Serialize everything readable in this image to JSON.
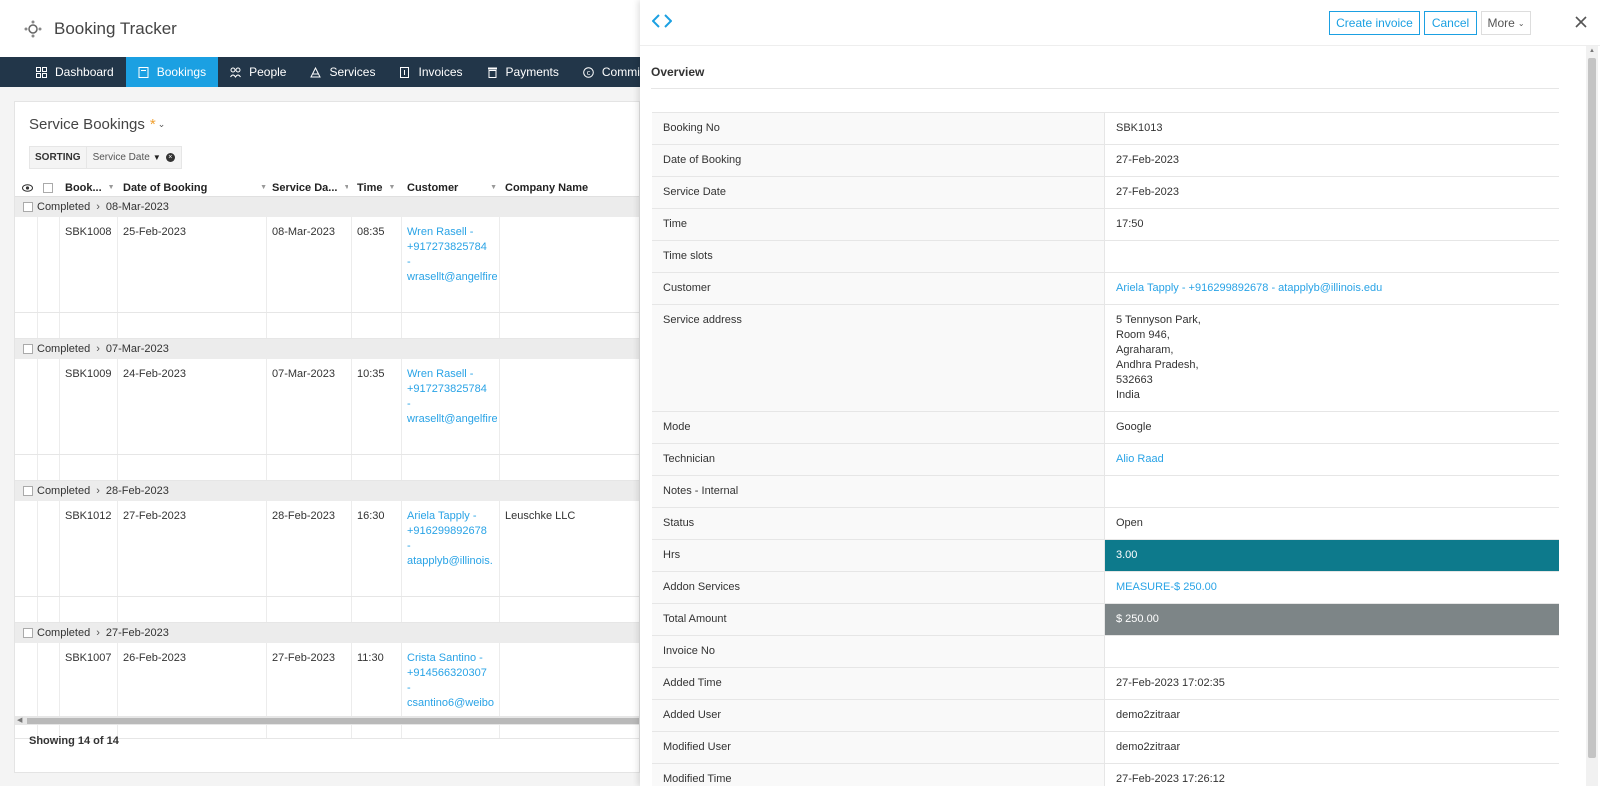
{
  "app": {
    "title": "Booking Tracker"
  },
  "nav": [
    {
      "label": "Dashboard",
      "icon": "dashboard-icon"
    },
    {
      "label": "Bookings",
      "icon": "bookings-icon",
      "active": true
    },
    {
      "label": "People",
      "icon": "people-icon"
    },
    {
      "label": "Services",
      "icon": "services-icon"
    },
    {
      "label": "Invoices",
      "icon": "invoices-icon"
    },
    {
      "label": "Payments",
      "icon": "payments-icon"
    },
    {
      "label": "Commis",
      "icon": "commission-icon"
    }
  ],
  "list": {
    "title": "Service Bookings",
    "star": "*",
    "sorting_label": "SORTING",
    "sort_chip": "Service Date",
    "columns": [
      "Book...",
      "Date of Booking",
      "Service Da...",
      "Time",
      "Customer",
      "Company Name"
    ],
    "groups": [
      {
        "status": "Completed",
        "date": "08-Mar-2023",
        "row": {
          "no": "SBK1008",
          "booking_date": "25-Feb-2023",
          "service_date": "08-Mar-2023",
          "time": "08:35",
          "customer": [
            "Wren Rasell -",
            "+917273825784",
            "-",
            "wrasellt@angelfire"
          ],
          "company": ""
        }
      },
      {
        "status": "Completed",
        "date": "07-Mar-2023",
        "row": {
          "no": "SBK1009",
          "booking_date": "24-Feb-2023",
          "service_date": "07-Mar-2023",
          "time": "10:35",
          "customer": [
            "Wren Rasell -",
            "+917273825784",
            "-",
            "wrasellt@angelfire"
          ],
          "company": ""
        }
      },
      {
        "status": "Completed",
        "date": "28-Feb-2023",
        "row": {
          "no": "SBK1012",
          "booking_date": "27-Feb-2023",
          "service_date": "28-Feb-2023",
          "time": "16:30",
          "customer": [
            "Ariela Tapply -",
            "+916299892678",
            "-",
            "atapplyb@illinois."
          ],
          "company": "Leuschke LLC"
        }
      },
      {
        "status": "Completed",
        "date": "27-Feb-2023",
        "row": {
          "no": "SBK1007",
          "booking_date": "26-Feb-2023",
          "service_date": "27-Feb-2023",
          "time": "11:30",
          "customer": [
            "Crista Santino -",
            "+914566320307",
            "-",
            "csantino6@weibo"
          ],
          "company": ""
        }
      }
    ],
    "footer": "Showing 14 of 14"
  },
  "panel": {
    "buttons": {
      "create_invoice": "Create invoice",
      "cancel": "Cancel",
      "more": "More"
    },
    "overview_title": "Overview",
    "fields": [
      {
        "label": "Booking No",
        "value": "SBK1013"
      },
      {
        "label": "Date of Booking",
        "value": "27-Feb-2023"
      },
      {
        "label": "Service Date",
        "value": "27-Feb-2023"
      },
      {
        "label": "Time",
        "value": "17:50"
      },
      {
        "label": "Time slots",
        "value": ""
      },
      {
        "label": "Customer",
        "value": "Ariela Tapply - +916299892678 - atapplyb@illinois.edu",
        "style": "link"
      },
      {
        "label": "Service address",
        "value": "5 Tennyson Park,\nRoom 946,\nAgraharam,\nAndhra Pradesh,\n532663\nIndia"
      },
      {
        "label": "Mode",
        "value": "Google"
      },
      {
        "label": "Technician",
        "value": "Alio Raad",
        "style": "link"
      },
      {
        "label": "Notes - Internal",
        "value": ""
      },
      {
        "label": "Status",
        "value": "Open"
      },
      {
        "label": "Hrs",
        "value": "3.00",
        "style": "teal"
      },
      {
        "label": "Addon Services",
        "value": "MEASURE-$ 250.00",
        "style": "link"
      },
      {
        "label": "Total Amount",
        "value": "$ 250.00",
        "style": "grey"
      },
      {
        "label": "Invoice No",
        "value": ""
      },
      {
        "label": "Added Time",
        "value": "27-Feb-2023 17:02:35"
      },
      {
        "label": "Added User",
        "value": "demo2zitraar"
      },
      {
        "label": "Modified User",
        "value": "demo2zitraar"
      },
      {
        "label": "Modified Time",
        "value": "27-Feb-2023 17:26:12"
      }
    ]
  },
  "colors": {
    "accent": "#1ba0e2",
    "nav_bg": "#223649",
    "teal": "#0d7a8c",
    "grey": "#7d8587",
    "link": "#29a3e6"
  }
}
